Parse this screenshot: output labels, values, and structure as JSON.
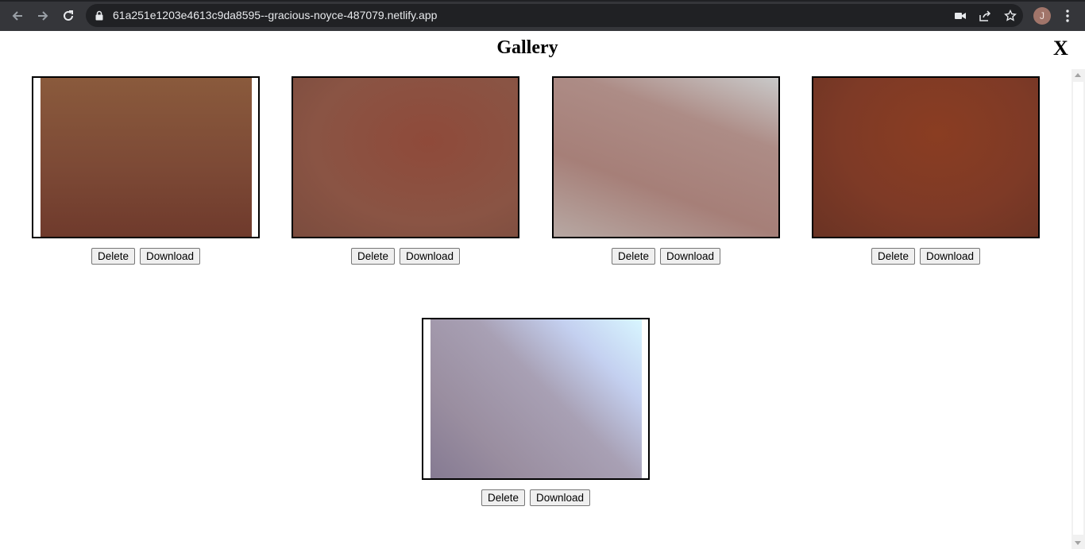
{
  "browser": {
    "url": "61a251e1203e4613c9da8595--gracious-noyce-487079.netlify.app",
    "profile_initial": "J",
    "icons": [
      "back-icon",
      "forward-icon",
      "reload-icon",
      "lock-icon",
      "camera-icon",
      "share-icon",
      "star-icon",
      "kebab-menu-icon"
    ]
  },
  "page": {
    "title": "Gallery",
    "close_label": "X"
  },
  "gallery": {
    "items": [
      {
        "delete_label": "Delete",
        "download_label": "Download",
        "colors": [
          "#8a5a3c",
          "#7a4330",
          "#6e3a2a"
        ]
      },
      {
        "delete_label": "Delete",
        "download_label": "Download",
        "colors": [
          "#8c5a48",
          "#8f4a3a",
          "#7d4838"
        ]
      },
      {
        "delete_label": "Delete",
        "download_label": "Download",
        "colors": [
          "#b08a82",
          "#a9827a",
          "#c8c4c4"
        ]
      },
      {
        "delete_label": "Delete",
        "download_label": "Download",
        "colors": [
          "#7e3a24",
          "#8a3d22",
          "#6a3222"
        ]
      },
      {
        "delete_label": "Delete",
        "download_label": "Download",
        "colors": [
          "#8a7a8a",
          "#b0a8b8",
          "#d8f4ff"
        ]
      }
    ]
  },
  "colors": {
    "chrome_bg": "#35363a",
    "omnibox_bg": "#202124",
    "avatar_bg": "#a1756a"
  }
}
